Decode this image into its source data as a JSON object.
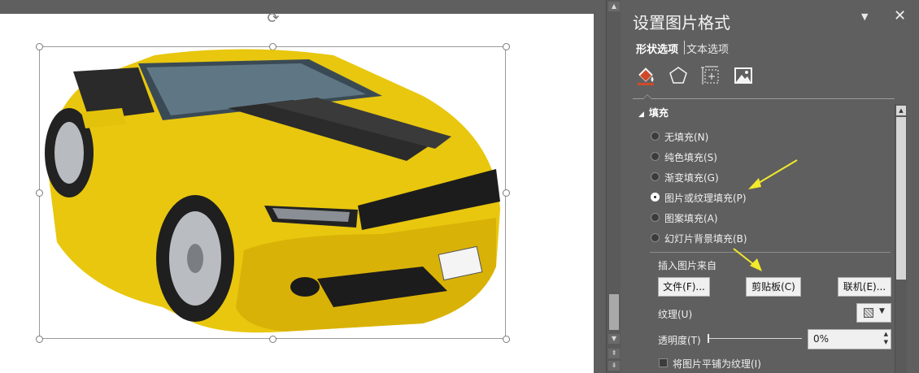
{
  "canvas": {
    "rotate_glyph": "⟳",
    "image_icon": "camaro-convertible-image"
  },
  "scrollbar": {
    "up": "▲",
    "down": "▼",
    "prev_page": "⇞",
    "next_page": "⇟"
  },
  "panel": {
    "title": "设置图片格式",
    "dropdown_glyph": "▼",
    "close_glyph": "✕",
    "tabs": [
      "形状选项",
      "文本选项"
    ],
    "category_icons": [
      "fill-line-icon",
      "effects-icon",
      "size-properties-icon",
      "picture-icon"
    ],
    "section_title": "填充",
    "section_toggle": "◢",
    "fill_options": [
      {
        "label": "无填充(N)",
        "selected": false
      },
      {
        "label": "纯色填充(S)",
        "selected": false
      },
      {
        "label": "渐变填充(G)",
        "selected": false
      },
      {
        "label": "图片或纹理填充(P)",
        "selected": true
      },
      {
        "label": "图案填充(A)",
        "selected": false
      },
      {
        "label": "幻灯片背景填充(B)",
        "selected": false
      }
    ],
    "insert_from_label": "插入图片来自",
    "buttons": {
      "file": "文件(F)...",
      "clipboard": "剪贴板(C)",
      "online": "联机(E)..."
    },
    "texture_label": "纹理(U)",
    "transparency_label": "透明度(T)",
    "transparency_value": "0%",
    "transparency_fraction": 0,
    "tile_label": "将图片平铺为纹理(I)",
    "tile_checked": false
  },
  "colors": {
    "panel_bg": "#5f5f5f",
    "accent_fill": "#d04a2a",
    "annotation_arrow": "#f2ea2a"
  }
}
